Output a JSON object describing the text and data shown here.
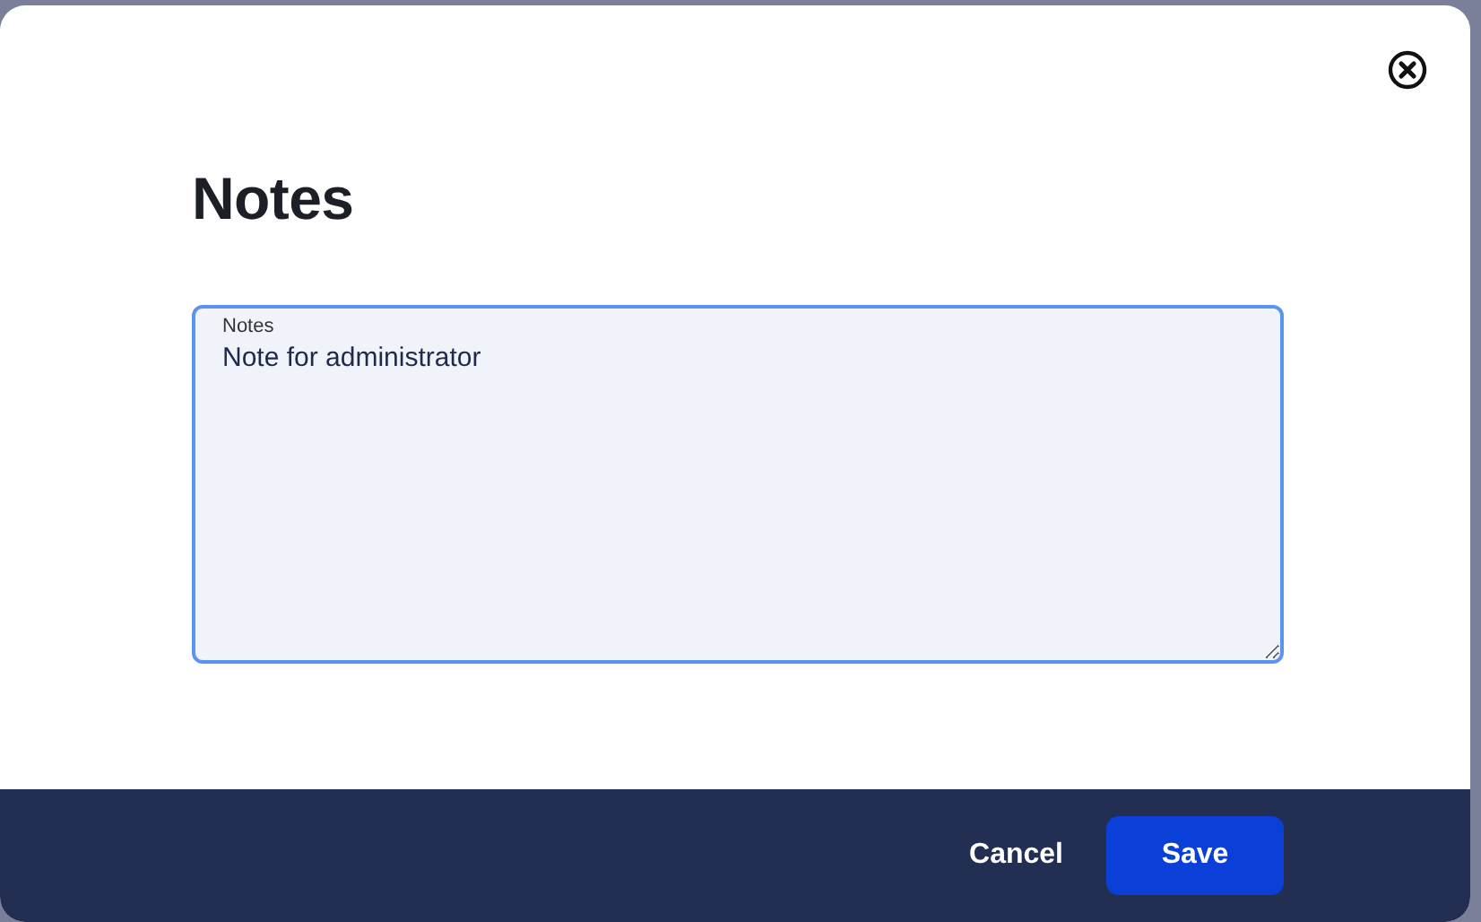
{
  "dialog": {
    "title": "Notes",
    "field": {
      "label": "Notes",
      "value": "Note for administrator"
    },
    "buttons": [
      {
        "label": "Cancel",
        "kind": "secondary"
      },
      {
        "label": "Save",
        "kind": "primary"
      }
    ]
  }
}
